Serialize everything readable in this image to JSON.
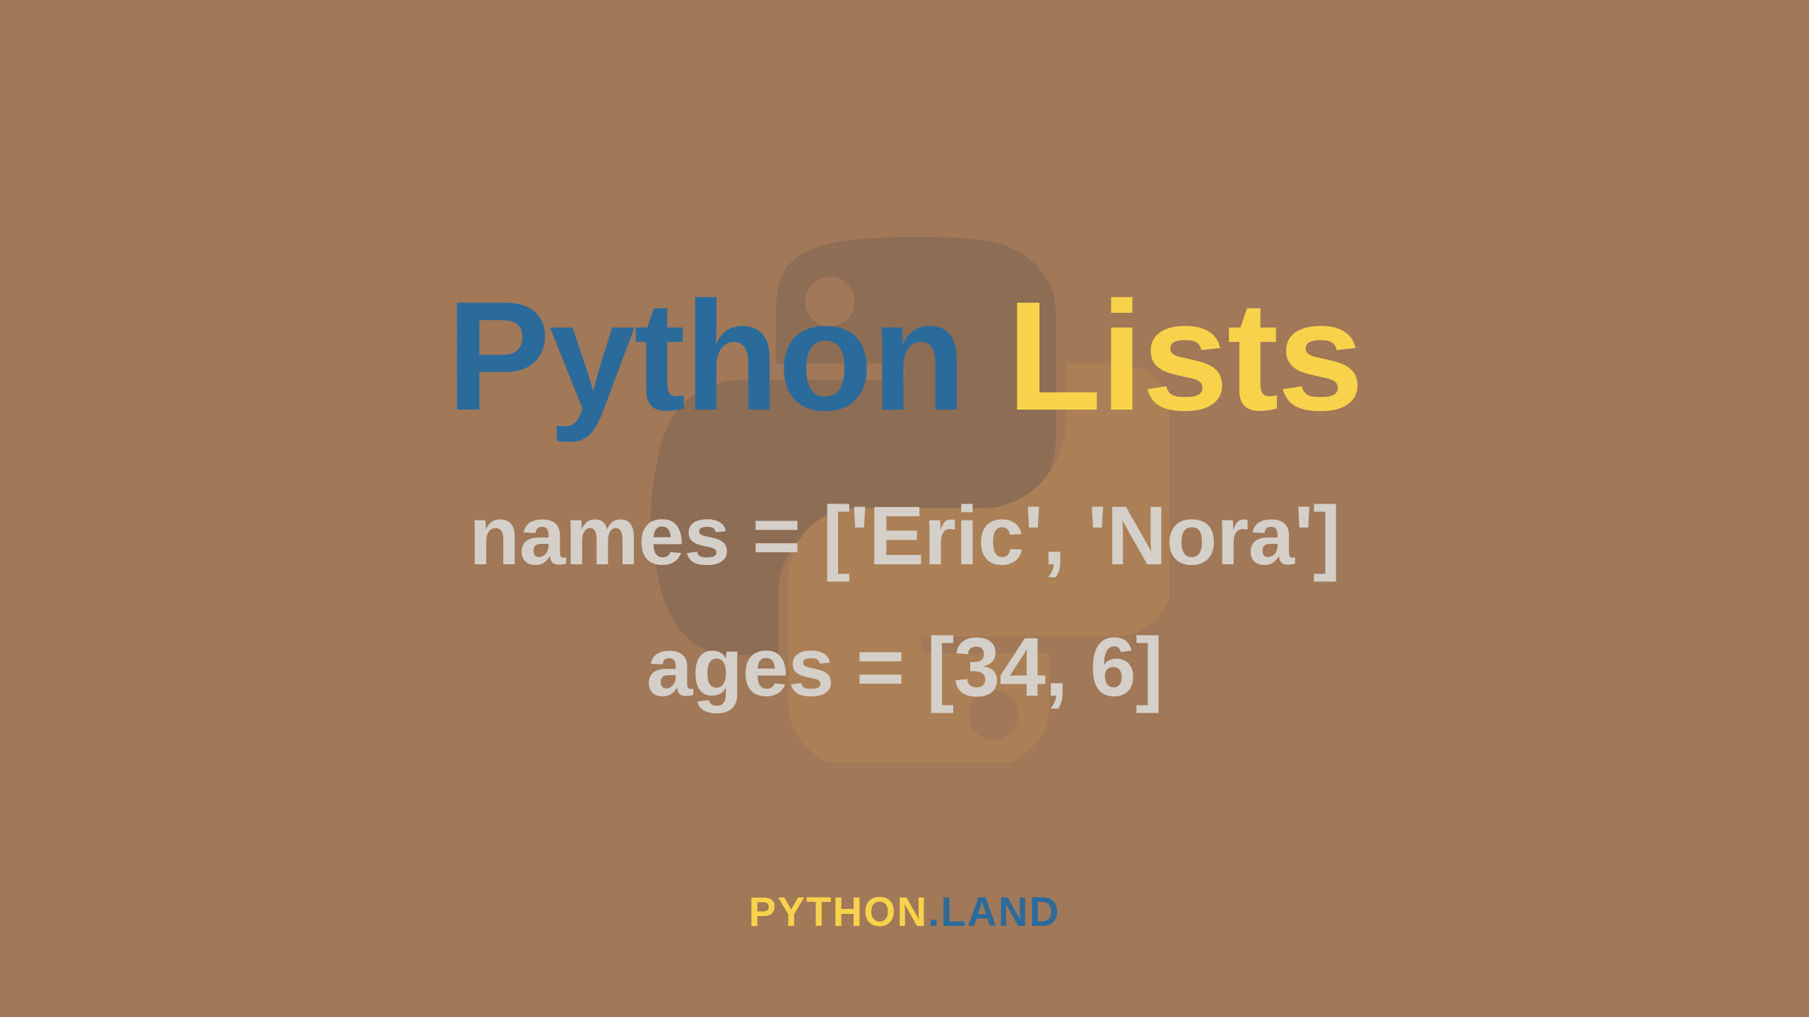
{
  "title": {
    "word1": "Python",
    "word2": "Lists"
  },
  "code": {
    "line1": "names = ['Eric', 'Nora']",
    "line2": "ages = [34, 6]"
  },
  "footer": {
    "part1": "PYTHON",
    "dot": ".",
    "part2": "LAND"
  }
}
